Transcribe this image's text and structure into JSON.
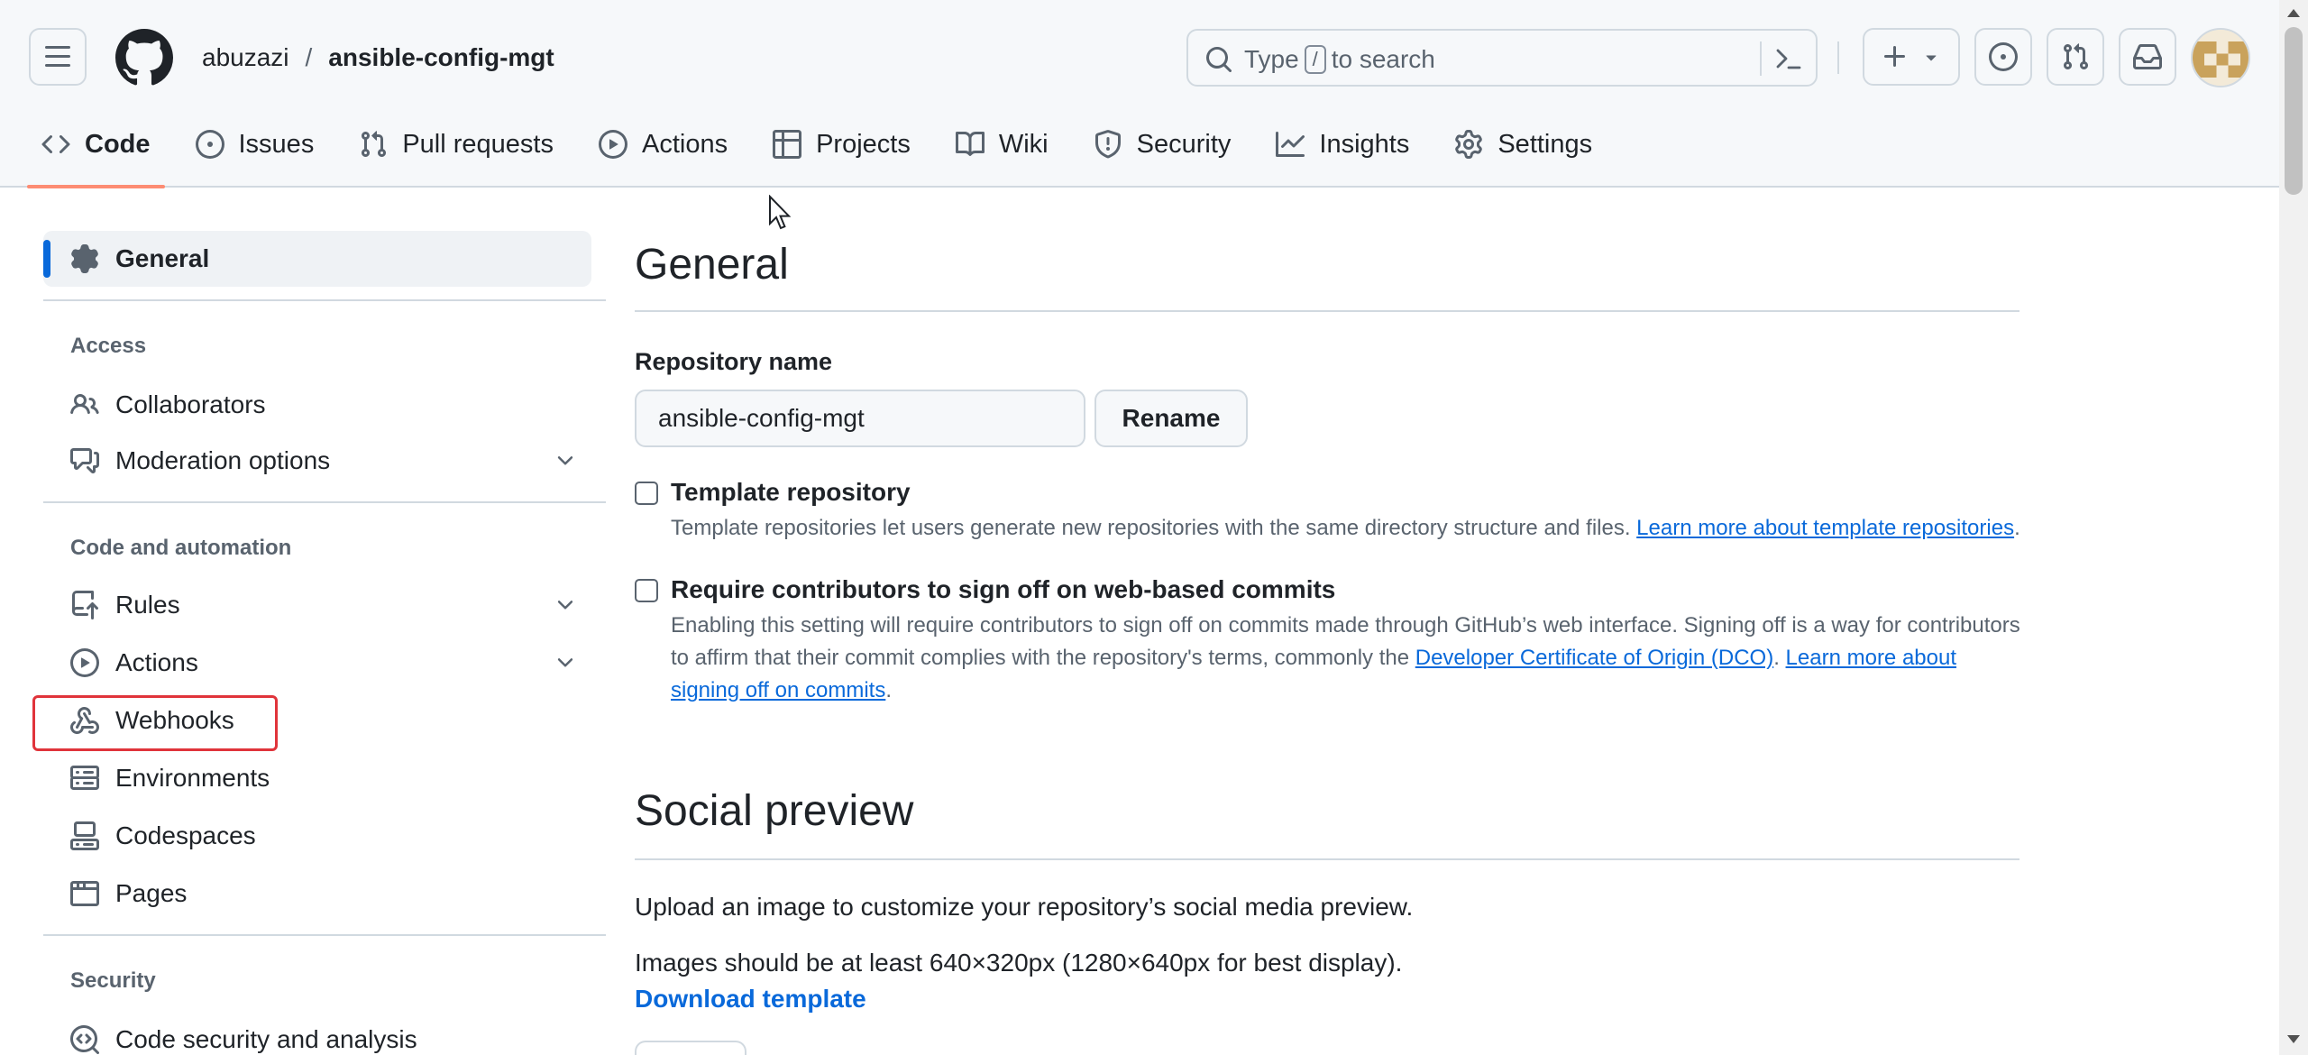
{
  "header": {
    "owner": "abuzazi",
    "separator": "/",
    "repo": "ansible-config-mgt",
    "search": {
      "before": "Type",
      "key": "/",
      "after": "to search"
    }
  },
  "repo_nav": [
    {
      "label": "Code",
      "icon": "code-icon",
      "selected": true
    },
    {
      "label": "Issues",
      "icon": "issue-opened-icon"
    },
    {
      "label": "Pull requests",
      "icon": "git-pull-request-icon"
    },
    {
      "label": "Actions",
      "icon": "play-icon"
    },
    {
      "label": "Projects",
      "icon": "table-icon"
    },
    {
      "label": "Wiki",
      "icon": "book-icon"
    },
    {
      "label": "Security",
      "icon": "shield-icon"
    },
    {
      "label": "Insights",
      "icon": "graph-icon"
    },
    {
      "label": "Settings",
      "icon": "gear-icon"
    }
  ],
  "sidebar": {
    "general": "General",
    "access_heading": "Access",
    "collaborators": "Collaborators",
    "moderation": "Moderation options",
    "code_heading": "Code and automation",
    "rules": "Rules",
    "actions": "Actions",
    "webhooks": "Webhooks",
    "environments": "Environments",
    "codespaces": "Codespaces",
    "pages": "Pages",
    "security_heading": "Security",
    "code_security": "Code security and analysis"
  },
  "main": {
    "title": "General",
    "repo_name_label": "Repository name",
    "repo_name_value": "ansible-config-mgt",
    "rename_label": "Rename",
    "template_title": "Template repository",
    "template_desc": "Template repositories let users generate new repositories with the same directory structure and files.",
    "template_link": "Learn more about template repositories",
    "signoff_title": "Require contributors to sign off on web-based commits",
    "signoff_desc_1": "Enabling this setting will require contributors to sign off on commits made through GitHub’s web interface. Signing off is a way for contributors to affirm that their commit complies with the repository's terms, commonly the",
    "signoff_link_dco": "Developer Certificate of Origin (DCO)",
    "signoff_link_learn": "Learn more about signing off on commits",
    "social_title": "Social preview",
    "social_desc": "Upload an image to customize your repository’s social media preview.",
    "social_size": "Images should be at least 640×320px (1280×640px for best display).",
    "download_template": "Download template"
  },
  "colors": {
    "accent": "#0969da",
    "selected_tab_underline": "#fd8c73",
    "highlight_box": "#e0343b"
  }
}
